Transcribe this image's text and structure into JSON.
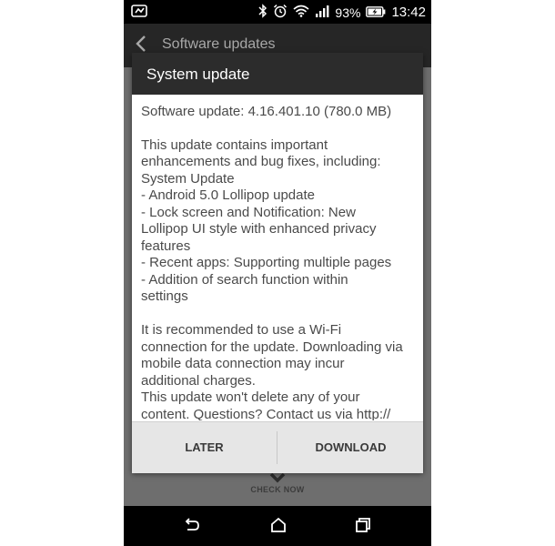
{
  "status_bar": {
    "icons": [
      "notification-icon",
      "bluetooth-icon",
      "alarm-icon",
      "wifi-icon",
      "signal-icon",
      "battery-charging-icon"
    ],
    "battery_percent": "93%",
    "time": "13:42"
  },
  "app_bar": {
    "title": "Software updates"
  },
  "background": {
    "check_now_label": "CHECK NOW"
  },
  "dialog": {
    "title": "System update",
    "version_line": "Software update: 4.16.401.10 (780.0 MB)",
    "description_lines": [
      "This update contains important",
      "enhancements and bug fixes, including:",
      "System Update",
      "- Android 5.0 Lollipop update",
      "- Lock screen and Notification: New",
      "Lollipop UI style with enhanced privacy",
      "features",
      "- Recent apps: Supporting multiple pages",
      "- Addition of search function within",
      "settings"
    ],
    "recommendation_lines": [
      "It is recommended to use a Wi-Fi",
      "connection for the update. Downloading via",
      "mobile data connection may incur",
      "additional charges.",
      "This update won't delete any of your",
      "content. Questions? Contact us via http://"
    ],
    "later_label": "LATER",
    "download_label": "DOWNLOAD"
  },
  "nav_bar": {
    "icons": [
      "back-icon",
      "home-icon",
      "recents-icon"
    ]
  }
}
